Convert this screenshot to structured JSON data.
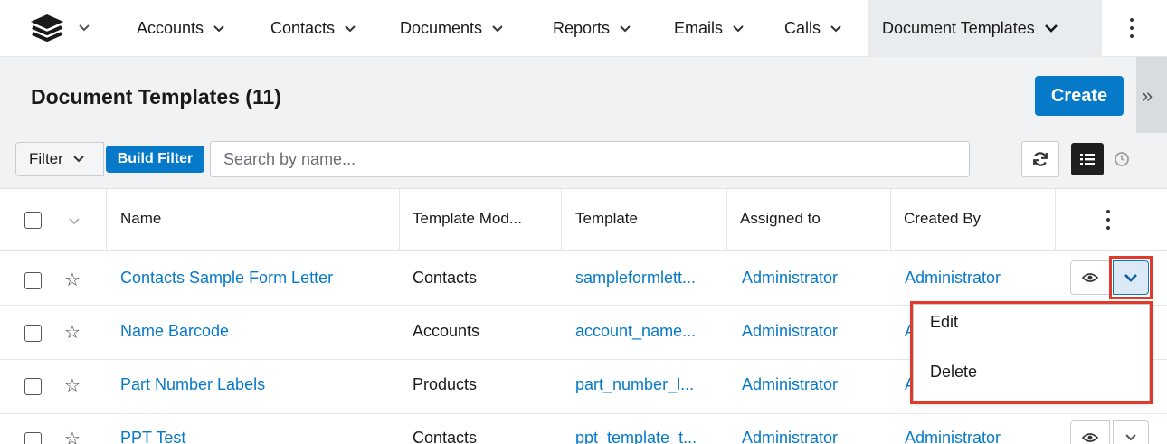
{
  "nav": {
    "tabs": [
      {
        "label": "Accounts"
      },
      {
        "label": "Contacts"
      },
      {
        "label": "Documents"
      },
      {
        "label": "Reports"
      },
      {
        "label": "Emails"
      },
      {
        "label": "Calls"
      },
      {
        "label": "Document Templates"
      }
    ]
  },
  "header": {
    "title": "Document Templates (11)",
    "create_label": "Create"
  },
  "filterbar": {
    "filter_label": "Filter",
    "build_filter_label": "Build Filter",
    "search_placeholder": "Search by name..."
  },
  "table": {
    "columns": [
      "Name",
      "Template Mod...",
      "Template",
      "Assigned to",
      "Created By"
    ],
    "rows": [
      {
        "name": "Contacts Sample Form Letter",
        "module": "Contacts",
        "template": "sampleformlett...",
        "assigned": "Administrator",
        "created": "Administrator"
      },
      {
        "name": "Name Barcode",
        "module": "Accounts",
        "template": "account_name...",
        "assigned": "Administrator",
        "created": "A"
      },
      {
        "name": "Part Number Labels",
        "module": "Products",
        "template": "part_number_l...",
        "assigned": "Administrator",
        "created": "A"
      },
      {
        "name": "PPT Test",
        "module": "Contacts",
        "template": "ppt_template_t...",
        "assigned": "Administrator",
        "created": "Administrator"
      }
    ]
  },
  "row_menu": {
    "items": [
      "Edit",
      "Delete"
    ]
  },
  "colors": {
    "accent": "#0679c8",
    "highlight": "#e03b2a"
  }
}
